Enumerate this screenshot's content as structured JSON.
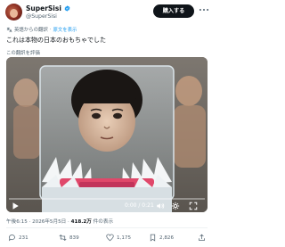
{
  "author": {
    "name": "SuperSisi",
    "handle": "@SuperSisi",
    "avatar_icon": "avatar-image",
    "verified": true
  },
  "header": {
    "follow_label": "購入する",
    "more_icon": "more-icon"
  },
  "translation": {
    "label": "英語からの翻訳",
    "link": "原文を表示"
  },
  "tweet": {
    "text": "これは本物の日本のおもちゃでした",
    "rate_translation": "この翻訳を評価"
  },
  "video": {
    "current_time": "0:00 / 0:21",
    "progress": 0.0,
    "play_icon": "play-icon",
    "controls": [
      "volume-icon",
      "settings-icon",
      "fullscreen-icon"
    ]
  },
  "meta": {
    "time": "午後6:15",
    "date": "2026年5月5日",
    "views_count": "418.2万",
    "views_label": "件の表示"
  },
  "actions": {
    "replies": "231",
    "retweets": "839",
    "likes": "1,175",
    "bookmarks": "2,826"
  },
  "colors": {
    "accent": "#1d9bf0",
    "text": "#0f1419",
    "muted": "#536471",
    "button": "#0f1419"
  }
}
